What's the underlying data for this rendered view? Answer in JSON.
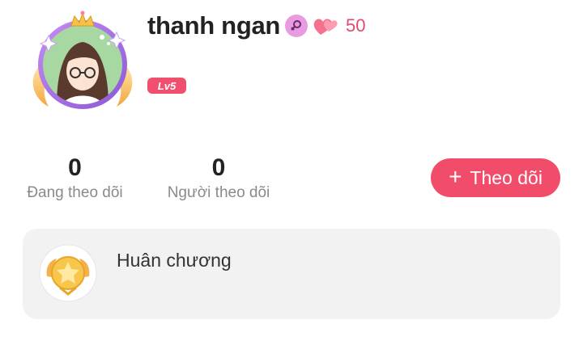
{
  "profile": {
    "username": "thanh ngan",
    "gender_icon": "female-symbol-icon",
    "heart_count": "50",
    "level": "Lv5"
  },
  "stats": {
    "following": {
      "value": "0",
      "label": "Đang theo dõi"
    },
    "followers": {
      "value": "0",
      "label": "Người theo dõi"
    }
  },
  "actions": {
    "follow_plus": "+",
    "follow_label": "Theo dõi"
  },
  "medals": {
    "title": "Huân chương",
    "icon": "medal-icon"
  },
  "colors": {
    "accent": "#f14d6b",
    "gender_badge": "#e89be0",
    "heart_count": "#e04a6e",
    "card_bg": "#f2f2f2"
  }
}
